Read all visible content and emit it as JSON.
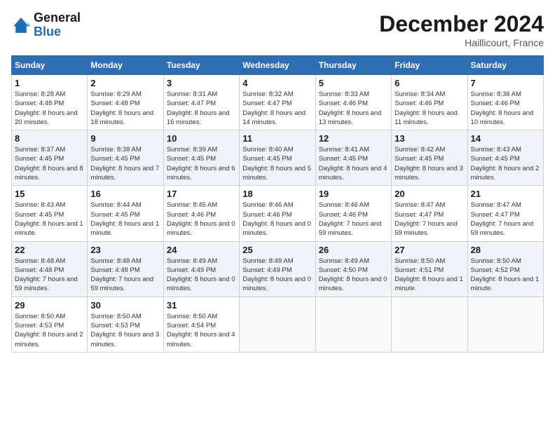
{
  "header": {
    "logo_line1": "General",
    "logo_line2": "Blue",
    "month": "December 2024",
    "location": "Haillicourt, France"
  },
  "weekdays": [
    "Sunday",
    "Monday",
    "Tuesday",
    "Wednesday",
    "Thursday",
    "Friday",
    "Saturday"
  ],
  "weeks": [
    [
      {
        "day": "1",
        "sunrise": "8:28 AM",
        "sunset": "4:48 PM",
        "daylight": "8 hours and 20 minutes."
      },
      {
        "day": "2",
        "sunrise": "8:29 AM",
        "sunset": "4:48 PM",
        "daylight": "8 hours and 18 minutes."
      },
      {
        "day": "3",
        "sunrise": "8:31 AM",
        "sunset": "4:47 PM",
        "daylight": "8 hours and 16 minutes."
      },
      {
        "day": "4",
        "sunrise": "8:32 AM",
        "sunset": "4:47 PM",
        "daylight": "8 hours and 14 minutes."
      },
      {
        "day": "5",
        "sunrise": "8:33 AM",
        "sunset": "4:46 PM",
        "daylight": "8 hours and 13 minutes."
      },
      {
        "day": "6",
        "sunrise": "8:34 AM",
        "sunset": "4:46 PM",
        "daylight": "8 hours and 11 minutes."
      },
      {
        "day": "7",
        "sunrise": "8:36 AM",
        "sunset": "4:46 PM",
        "daylight": "8 hours and 10 minutes."
      }
    ],
    [
      {
        "day": "8",
        "sunrise": "8:37 AM",
        "sunset": "4:45 PM",
        "daylight": "8 hours and 8 minutes."
      },
      {
        "day": "9",
        "sunrise": "8:38 AM",
        "sunset": "4:45 PM",
        "daylight": "8 hours and 7 minutes."
      },
      {
        "day": "10",
        "sunrise": "8:39 AM",
        "sunset": "4:45 PM",
        "daylight": "8 hours and 6 minutes."
      },
      {
        "day": "11",
        "sunrise": "8:40 AM",
        "sunset": "4:45 PM",
        "daylight": "8 hours and 5 minutes."
      },
      {
        "day": "12",
        "sunrise": "8:41 AM",
        "sunset": "4:45 PM",
        "daylight": "8 hours and 4 minutes."
      },
      {
        "day": "13",
        "sunrise": "8:42 AM",
        "sunset": "4:45 PM",
        "daylight": "8 hours and 3 minutes."
      },
      {
        "day": "14",
        "sunrise": "8:43 AM",
        "sunset": "4:45 PM",
        "daylight": "8 hours and 2 minutes."
      }
    ],
    [
      {
        "day": "15",
        "sunrise": "8:43 AM",
        "sunset": "4:45 PM",
        "daylight": "8 hours and 1 minute."
      },
      {
        "day": "16",
        "sunrise": "8:44 AM",
        "sunset": "4:45 PM",
        "daylight": "8 hours and 1 minute."
      },
      {
        "day": "17",
        "sunrise": "8:45 AM",
        "sunset": "4:46 PM",
        "daylight": "8 hours and 0 minutes."
      },
      {
        "day": "18",
        "sunrise": "8:46 AM",
        "sunset": "4:46 PM",
        "daylight": "8 hours and 0 minutes."
      },
      {
        "day": "19",
        "sunrise": "8:46 AM",
        "sunset": "4:46 PM",
        "daylight": "7 hours and 59 minutes."
      },
      {
        "day": "20",
        "sunrise": "8:47 AM",
        "sunset": "4:47 PM",
        "daylight": "7 hours and 59 minutes."
      },
      {
        "day": "21",
        "sunrise": "8:47 AM",
        "sunset": "4:47 PM",
        "daylight": "7 hours and 59 minutes."
      }
    ],
    [
      {
        "day": "22",
        "sunrise": "8:48 AM",
        "sunset": "4:48 PM",
        "daylight": "7 hours and 59 minutes."
      },
      {
        "day": "23",
        "sunrise": "8:48 AM",
        "sunset": "4:48 PM",
        "daylight": "7 hours and 59 minutes."
      },
      {
        "day": "24",
        "sunrise": "8:49 AM",
        "sunset": "4:49 PM",
        "daylight": "8 hours and 0 minutes."
      },
      {
        "day": "25",
        "sunrise": "8:49 AM",
        "sunset": "4:49 PM",
        "daylight": "8 hours and 0 minutes."
      },
      {
        "day": "26",
        "sunrise": "8:49 AM",
        "sunset": "4:50 PM",
        "daylight": "8 hours and 0 minutes."
      },
      {
        "day": "27",
        "sunrise": "8:50 AM",
        "sunset": "4:51 PM",
        "daylight": "8 hours and 1 minute."
      },
      {
        "day": "28",
        "sunrise": "8:50 AM",
        "sunset": "4:52 PM",
        "daylight": "8 hours and 1 minute."
      }
    ],
    [
      {
        "day": "29",
        "sunrise": "8:50 AM",
        "sunset": "4:53 PM",
        "daylight": "8 hours and 2 minutes."
      },
      {
        "day": "30",
        "sunrise": "8:50 AM",
        "sunset": "4:53 PM",
        "daylight": "8 hours and 3 minutes."
      },
      {
        "day": "31",
        "sunrise": "8:50 AM",
        "sunset": "4:54 PM",
        "daylight": "8 hours and 4 minutes."
      },
      null,
      null,
      null,
      null
    ]
  ]
}
